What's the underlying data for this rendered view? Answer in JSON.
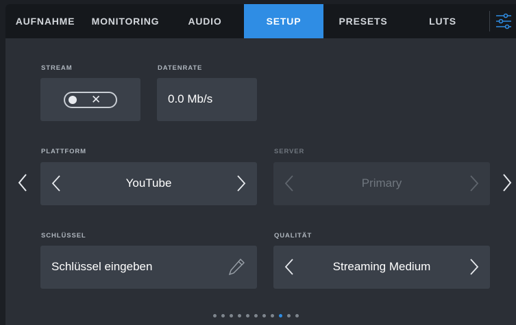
{
  "tabs": [
    {
      "label": "AUFNAHME"
    },
    {
      "label": "MONITORING"
    },
    {
      "label": "AUDIO"
    },
    {
      "label": "SETUP",
      "active": true
    },
    {
      "label": "PRESETS"
    },
    {
      "label": "LUTS"
    }
  ],
  "settings_icon": "sliders-icon",
  "stream": {
    "label": "STREAM",
    "state": "off",
    "icon": "x-icon"
  },
  "datenrate": {
    "label": "DATENRATE",
    "value": "0.0 Mb/s"
  },
  "plattform": {
    "label": "PLATTFORM",
    "value": "YouTube"
  },
  "server": {
    "label": "SERVER",
    "value": "Primary",
    "enabled": false
  },
  "schluessel": {
    "label": "SCHLÜSSEL",
    "placeholder": "Schlüssel eingeben",
    "icon": "pencil-icon"
  },
  "qualitaet": {
    "label": "QUALITÄT",
    "value": "Streaming Medium"
  },
  "pagination": {
    "total": 11,
    "current": 9
  },
  "colors": {
    "accent": "#2f8de4",
    "tabbar": "#15181c",
    "panel": "#2b2f36",
    "tile": "#3a4049"
  }
}
